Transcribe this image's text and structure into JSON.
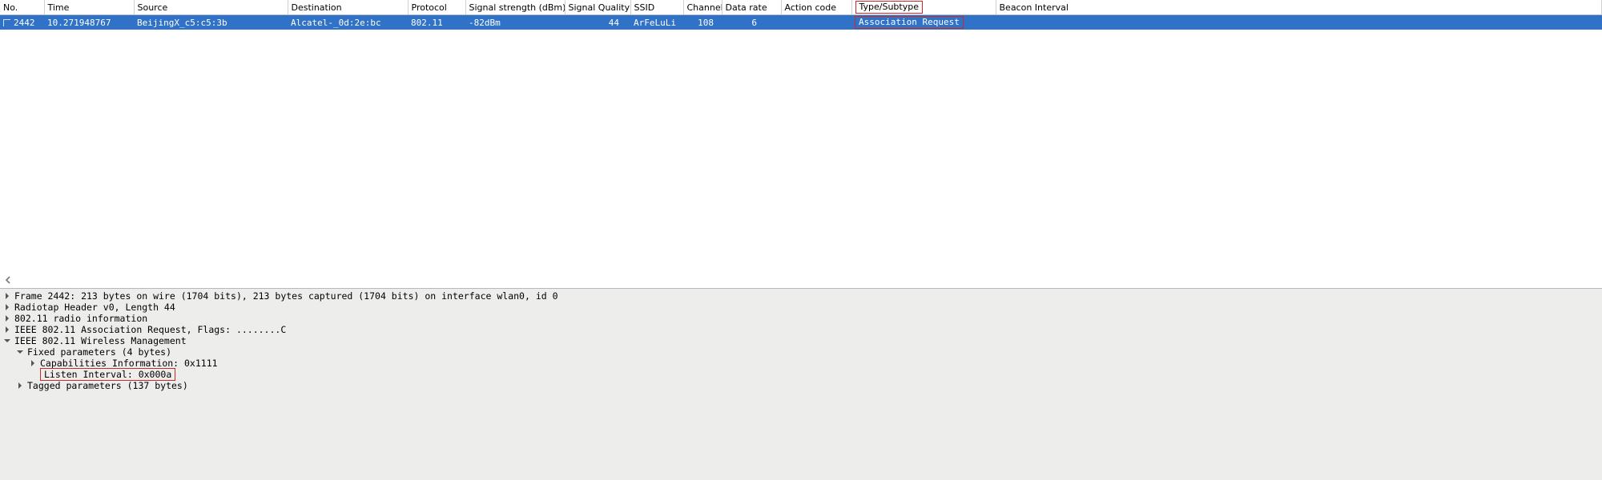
{
  "columns": {
    "no": "No.",
    "time": "Time",
    "src": "Source",
    "dst": "Destination",
    "proto": "Protocol",
    "sig": "Signal strength (dBm)",
    "qual": "Signal Quality",
    "ssid": "SSID",
    "chan": "Channel",
    "rate": "Data rate",
    "act": "Action code",
    "type": "Type/Subtype",
    "bint": "Beacon Interval"
  },
  "row": {
    "no": "2442",
    "time": "10.271948767",
    "src": "BeijingX_c5:c5:3b",
    "dst": "Alcatel-_0d:2e:bc",
    "proto": "802.11",
    "sig": "-82dBm",
    "qual": "44",
    "ssid": "ArFeLuLi",
    "chan": "108",
    "rate": "6",
    "act": "",
    "type": "Association Request",
    "bint": ""
  },
  "details": {
    "frame": "Frame 2442: 213 bytes on wire (1704 bits), 213 bytes captured (1704 bits) on interface wlan0, id 0",
    "radiotap": "Radiotap Header v0, Length 44",
    "radio": "802.11 radio information",
    "assocreq": "IEEE 802.11 Association Request, Flags: ........C",
    "wmgmt": "IEEE 802.11 Wireless Management",
    "fixed": "Fixed parameters (4 bytes)",
    "caps": "Capabilities Information: 0x1111",
    "listen": "Listen Interval: 0x000a",
    "tagged": "Tagged parameters (137 bytes)"
  }
}
